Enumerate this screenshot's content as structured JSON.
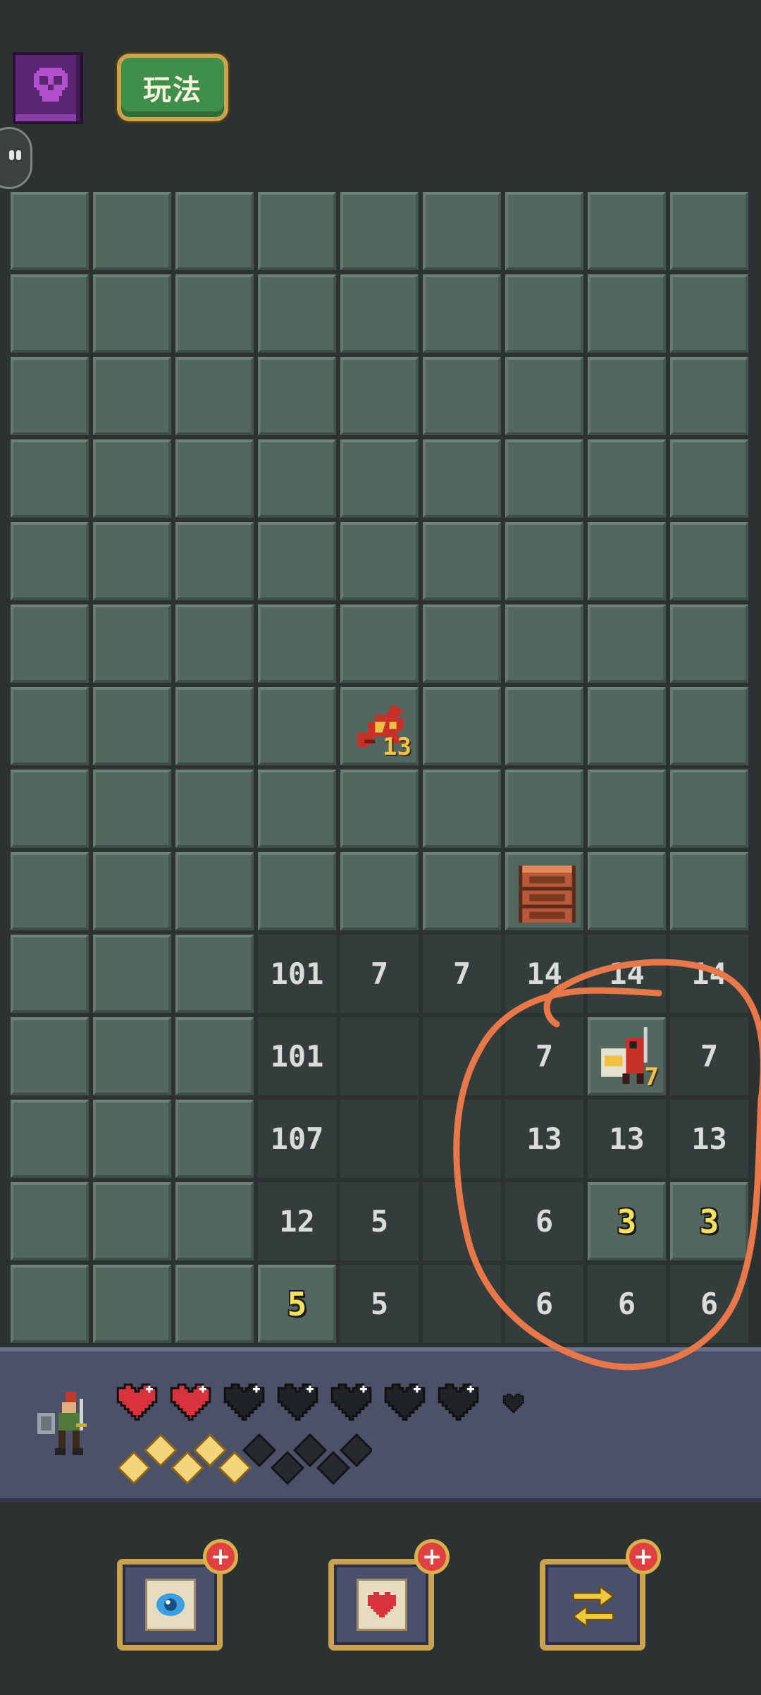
{
  "header": {
    "monster_book_icon": "skull-book-icon",
    "howto_label": "玩法"
  },
  "board": {
    "columns": 9,
    "rows": 14,
    "cells": [
      [
        "h",
        "h",
        "h",
        "h",
        "h",
        "h",
        "h",
        "h",
        "h"
      ],
      [
        "h",
        "h",
        "h",
        "h",
        "h",
        "h",
        "h",
        "h",
        "h"
      ],
      [
        "h",
        "h",
        "h",
        "h",
        "h",
        "h",
        "h",
        "h",
        "h"
      ],
      [
        "h",
        "h",
        "h",
        "h",
        "h",
        "h",
        "h",
        "h",
        "h"
      ],
      [
        "h",
        "h",
        "h",
        "h",
        "h",
        "h",
        "h",
        "h",
        "h"
      ],
      [
        "h",
        "h",
        "h",
        "h",
        "h",
        "h",
        "h",
        "h",
        "h"
      ],
      [
        "h",
        "h",
        "h",
        "h",
        {
          "monster": "dragon",
          "level": "13"
        },
        "h",
        "h",
        "h",
        "h"
      ],
      [
        "h",
        "h",
        "h",
        "h",
        "h",
        "h",
        "h",
        "h",
        "h"
      ],
      [
        "h",
        "h",
        "h",
        "h",
        "h",
        "h",
        {
          "item": "treasure-chest"
        },
        "h",
        "h"
      ],
      [
        "h",
        "h",
        "h",
        {
          "n": "101"
        },
        {
          "n": "7"
        },
        {
          "n": "7"
        },
        {
          "n": "14"
        },
        {
          "n": "14"
        },
        {
          "n": "14"
        }
      ],
      [
        "h",
        "h",
        "h",
        {
          "n": "101"
        },
        {
          "n": ""
        },
        {
          "n": ""
        },
        {
          "n": "7"
        },
        {
          "monster": "knight",
          "level": "7"
        },
        {
          "n": "7"
        }
      ],
      [
        "h",
        "h",
        "h",
        {
          "n": "107"
        },
        {
          "n": ""
        },
        {
          "n": ""
        },
        {
          "n": "13"
        },
        {
          "n": "13"
        },
        {
          "n": "13"
        }
      ],
      [
        "h",
        "h",
        "h",
        {
          "n": "12"
        },
        {
          "n": "5"
        },
        {
          "n": ""
        },
        {
          "n": "6"
        },
        {
          "n": "3",
          "style": "yellow",
          "hl": true
        },
        {
          "n": "3",
          "style": "yellow",
          "hl": true
        }
      ],
      [
        "h",
        "h",
        "h",
        {
          "n": "5",
          "style": "yellow",
          "hl": true
        },
        {
          "n": "5"
        },
        {
          "n": ""
        },
        {
          "n": "6"
        },
        {
          "n": "6"
        },
        {
          "n": "6"
        }
      ]
    ]
  },
  "status": {
    "hero_icon": "hero-knight-icon",
    "hearts_full": 2,
    "hearts_empty": 5,
    "hearts_total": 7,
    "gems_full": 5,
    "gems_empty": 5
  },
  "items": [
    {
      "icon": "eye-scroll-icon",
      "plus_label": "+"
    },
    {
      "icon": "heart-scroll-icon",
      "plus_label": "+"
    },
    {
      "icon": "swap-arrows-icon",
      "plus_label": "+"
    }
  ],
  "colors": {
    "background": "#2b3231",
    "hidden_tile": "#54675f",
    "open_tile": "#343d3b",
    "annotation": "#e8784a",
    "status_bar": "#4c5068"
  }
}
